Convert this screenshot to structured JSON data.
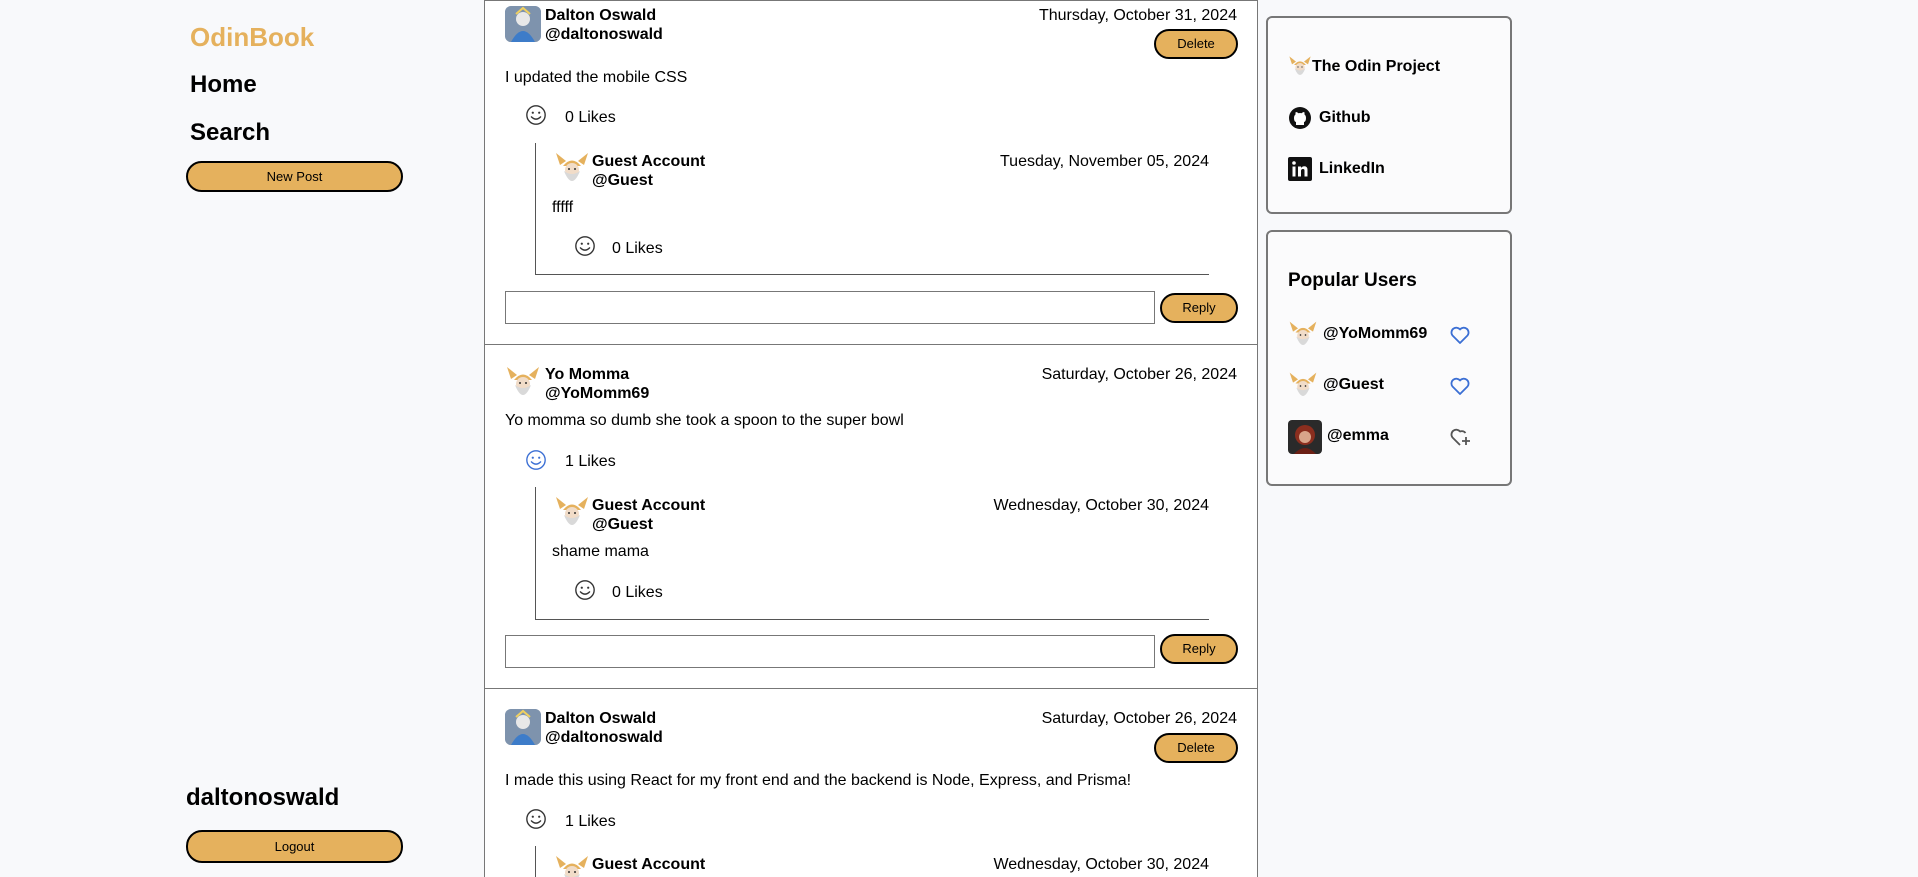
{
  "sidebar": {
    "brand": "OdinBook",
    "nav": {
      "home": "Home",
      "search": "Search"
    },
    "new_post": "New Post",
    "username": "daltonoswald",
    "logout": "Logout"
  },
  "posts": [
    {
      "name": "Dalton Oswald",
      "handle": "@daltonoswald",
      "date": "Thursday, October 31, 2024",
      "delete": "Delete",
      "body": "I updated the mobile CSS",
      "likes": "0 Likes",
      "liked": false,
      "comment": {
        "name": "Guest Account",
        "handle": "@Guest",
        "date": "Tuesday, November 05, 2024",
        "body": "fffff",
        "likes": "0 Likes"
      },
      "reply": "Reply"
    },
    {
      "name": "Yo Momma",
      "handle": "@YoMomm69",
      "date": "Saturday, October 26, 2024",
      "body": "Yo momma so dumb she took a spoon to the super bowl",
      "likes": "1 Likes",
      "liked": true,
      "comment": {
        "name": "Guest Account",
        "handle": "@Guest",
        "date": "Wednesday, October 30, 2024",
        "body": "shame mama",
        "likes": "0 Likes"
      },
      "reply": "Reply"
    },
    {
      "name": "Dalton Oswald",
      "handle": "@daltonoswald",
      "date": "Saturday, October 26, 2024",
      "delete": "Delete",
      "body": "I made this using React for my front end and the backend is Node, Express, and Prisma!",
      "likes": "1 Likes",
      "liked": false,
      "comment": {
        "name": "Guest Account",
        "date": "Wednesday, October 30, 2024"
      }
    }
  ],
  "links": [
    {
      "label": "The Odin Project",
      "icon": "odin-project-icon"
    },
    {
      "label": "Github",
      "icon": "github-icon"
    },
    {
      "label": "LinkedIn",
      "icon": "linkedin-icon"
    }
  ],
  "popular": {
    "title": "Popular Users",
    "users": [
      {
        "handle": "@YoMomm69",
        "status": "following",
        "icon": "heart-icon"
      },
      {
        "handle": "@Guest",
        "status": "following",
        "icon": "heart-icon"
      },
      {
        "handle": "@emma",
        "status": "not-following",
        "icon": "heart-plus-icon"
      }
    ]
  },
  "colors": {
    "accent": "#e5b15d",
    "liked": "#3b6fd4",
    "border": "#777777",
    "background": "#f8f9fb"
  }
}
